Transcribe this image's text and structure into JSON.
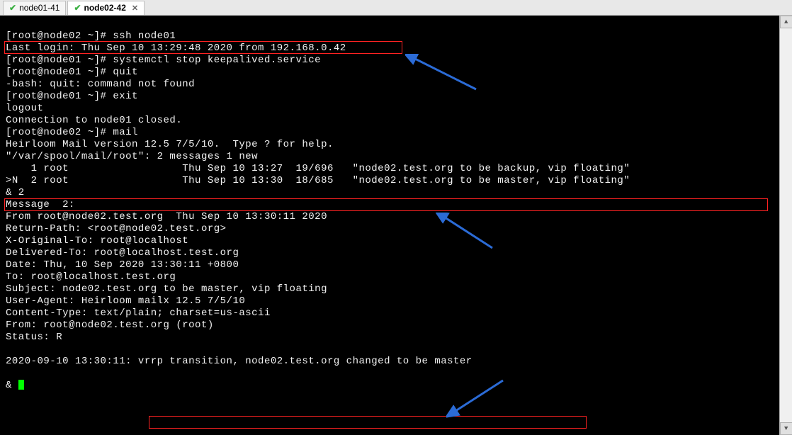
{
  "tabs": [
    {
      "label": "node01-41",
      "active": false
    },
    {
      "label": "node02-42",
      "active": true
    }
  ],
  "terminal": {
    "lines": [
      "[root@node02 ~]# ssh node01",
      "Last login: Thu Sep 10 13:29:48 2020 from 192.168.0.42",
      "[root@node01 ~]# systemctl stop keepalived.service",
      "[root@node01 ~]# quit",
      "-bash: quit: command not found",
      "[root@node01 ~]# exit",
      "logout",
      "Connection to node01 closed.",
      "[root@node02 ~]# mail",
      "Heirloom Mail version 12.5 7/5/10.  Type ? for help.",
      "\"/var/spool/mail/root\": 2 messages 1 new",
      "    1 root                  Thu Sep 10 13:27  19/696   \"node02.test.org to be backup, vip floating\"",
      ">N  2 root                  Thu Sep 10 13:30  18/685   \"node02.test.org to be master, vip floating\"",
      "& 2",
      "Message  2:",
      "From root@node02.test.org  Thu Sep 10 13:30:11 2020",
      "Return-Path: <root@node02.test.org>",
      "X-Original-To: root@localhost",
      "Delivered-To: root@localhost.test.org",
      "Date: Thu, 10 Sep 2020 13:30:11 +0800",
      "To: root@localhost.test.org",
      "Subject: node02.test.org to be master, vip floating",
      "User-Agent: Heirloom mailx 12.5 7/5/10",
      "Content-Type: text/plain; charset=us-ascii",
      "From: root@node02.test.org (root)",
      "Status: R",
      "",
      "2020-09-10 13:30:11: vrrp transition, node02.test.org changed to be master",
      "",
      "& "
    ]
  },
  "annotations": {
    "highlighted_command": "systemctl stop keepalived.service",
    "highlighted_mail_line": ">N  2 root                  Thu Sep 10 13:30  18/685   \"node02.test.org to be master, vip floating\"",
    "highlighted_log": "vrrp transition, node02.test.org changed to be master"
  }
}
